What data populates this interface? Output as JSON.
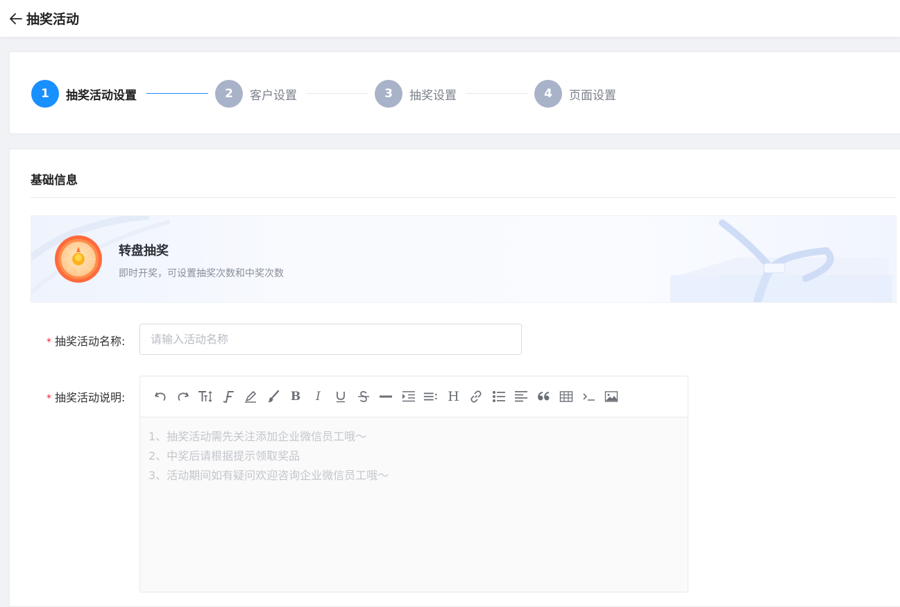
{
  "header": {
    "back_icon": "arrow-left-icon",
    "title": "抽奖活动"
  },
  "steps": [
    {
      "number": "1",
      "label": "抽奖活动设置",
      "state": "active"
    },
    {
      "number": "2",
      "label": "客户设置",
      "state": "inactive"
    },
    {
      "number": "3",
      "label": "抽奖设置",
      "state": "inactive"
    },
    {
      "number": "4",
      "label": "页面设置",
      "state": "inactive"
    }
  ],
  "section": {
    "title": "基础信息"
  },
  "banner": {
    "title": "转盘抽奖",
    "description": "即时开奖，可设置抽奖次数和中奖次数",
    "icon": "prize-wheel-icon"
  },
  "form": {
    "name_label": "抽奖活动名称:",
    "name_placeholder": "请输入活动名称",
    "name_value": "",
    "desc_label": "抽奖活动说明:",
    "desc_lines": [
      "1、抽奖活动需先关注添加企业微信员工哦～",
      "2、中奖后请根据提示领取奖品",
      "3、活动期间如有疑问欢迎咨询企业微信员工哦～"
    ]
  },
  "toolbar_icons": [
    "undo-icon",
    "redo-icon",
    "font-size-icon",
    "font-family-icon",
    "highlight-icon",
    "brush-icon",
    "bold-icon",
    "italic-icon",
    "underline-icon",
    "strikethrough-icon",
    "horizontal-rule-icon",
    "indent-icon",
    "line-height-icon",
    "heading-icon",
    "link-icon",
    "bullet-list-icon",
    "align-icon",
    "quote-icon",
    "table-icon",
    "code-icon",
    "image-icon"
  ],
  "colors": {
    "primary": "#1890ff",
    "step_inactive": "#a8b2c8",
    "required": "#f5222d"
  }
}
